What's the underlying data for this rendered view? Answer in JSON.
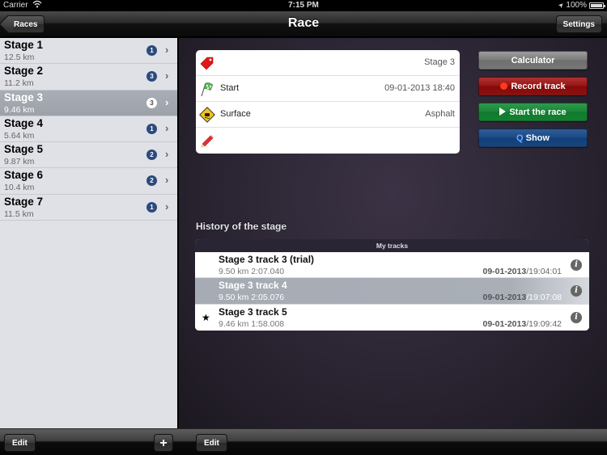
{
  "status_bar": {
    "carrier": "Carrier",
    "time": "7:15 PM",
    "battery": "100%"
  },
  "nav": {
    "title": "Race",
    "back_label": "Races",
    "settings_label": "Settings"
  },
  "stages": [
    {
      "name": "Stage 1",
      "distance": "12.5 km",
      "count": "1",
      "selected": false
    },
    {
      "name": "Stage 2",
      "distance": "11.2 km",
      "count": "3",
      "selected": false
    },
    {
      "name": "Stage 3",
      "distance": "9.46 km",
      "count": "3",
      "selected": true
    },
    {
      "name": "Stage 4",
      "distance": "5.64 km",
      "count": "1",
      "selected": false
    },
    {
      "name": "Stage 5",
      "distance": "9.87 km",
      "count": "2",
      "selected": false
    },
    {
      "name": "Stage 6",
      "distance": "10.4 km",
      "count": "2",
      "selected": false
    },
    {
      "name": "Stage 7",
      "distance": "11.5 km",
      "count": "1",
      "selected": false
    }
  ],
  "info": {
    "name_value": "Stage 3",
    "start_label": "Start",
    "start_value": "09-01-2013 18:40",
    "surface_label": "Surface",
    "surface_value": "Asphalt",
    "note_value": ""
  },
  "actions": {
    "calculator": "Calculator",
    "record": "Record track",
    "start": "Start the race",
    "show": "Show",
    "colors": {
      "record": "#8c1010",
      "start": "#13802f",
      "show": "#16457f",
      "calculator": "#777777"
    }
  },
  "history": {
    "title": "History of the stage",
    "header": "My tracks",
    "tracks": [
      {
        "name": "Stage 3 track 3 (trial)",
        "info": "9.50 km 2:07.040",
        "date": "09-01-2013",
        "time": "19:04:01",
        "starred": false,
        "selected": false
      },
      {
        "name": "Stage 3 track 4",
        "info": "9.50 km 2:05.076",
        "date": "09-01-2013",
        "time": "19:07:08",
        "starred": false,
        "selected": true
      },
      {
        "name": "Stage 3 track 5",
        "info": "9.46 km 1:58.008",
        "date": "09-01-2013",
        "time": "19:09:42",
        "starred": true,
        "selected": false
      }
    ]
  },
  "toolbar": {
    "edit_left": "Edit",
    "add": "+",
    "edit_right": "Edit"
  },
  "icons": {
    "star": "★",
    "chevron": "›",
    "info": "i",
    "wifi": "wifi-icon",
    "location": "➤"
  }
}
